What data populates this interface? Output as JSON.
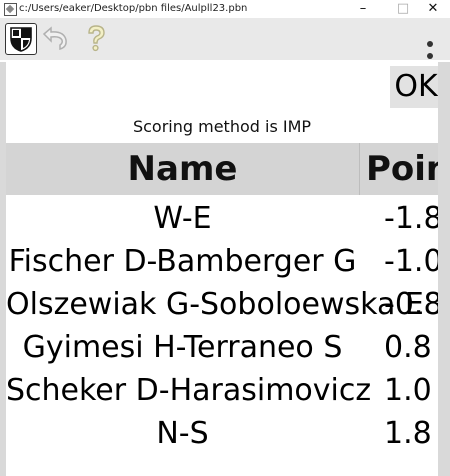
{
  "window": {
    "title": "c:/Users/eaker/Desktop/pbn files/Aulpll23.pbn",
    "min_glyph": "–",
    "max_glyph": "□",
    "close_glyph": "✕"
  },
  "toolbar": {
    "icons": [
      "logo-icon",
      "undo-icon",
      "help-icon",
      "kebab-menu-icon"
    ]
  },
  "dialog": {
    "ok_label": "OK",
    "scoring_text": "Scoring method is IMP",
    "table": {
      "columns": [
        "Name",
        "Point"
      ],
      "rows": [
        {
          "name": "W-E",
          "points": "-1.8"
        },
        {
          "name": "Fischer D-Bamberger G",
          "points": "-1.0"
        },
        {
          "name": "Olszewiak G-Soboloewska E",
          "points": "-0.8"
        },
        {
          "name": "Gyimesi H-Terraneo S",
          "points": "0.8"
        },
        {
          "name": "Scheker D-Harasimovicz",
          "points": "1.0"
        },
        {
          "name": "N-S",
          "points": "1.8"
        }
      ]
    }
  },
  "colors": {
    "toolbar_bg": "#e9e9e9",
    "header_bg": "#d4d4d4",
    "ok_bg": "#e2e2e2"
  }
}
